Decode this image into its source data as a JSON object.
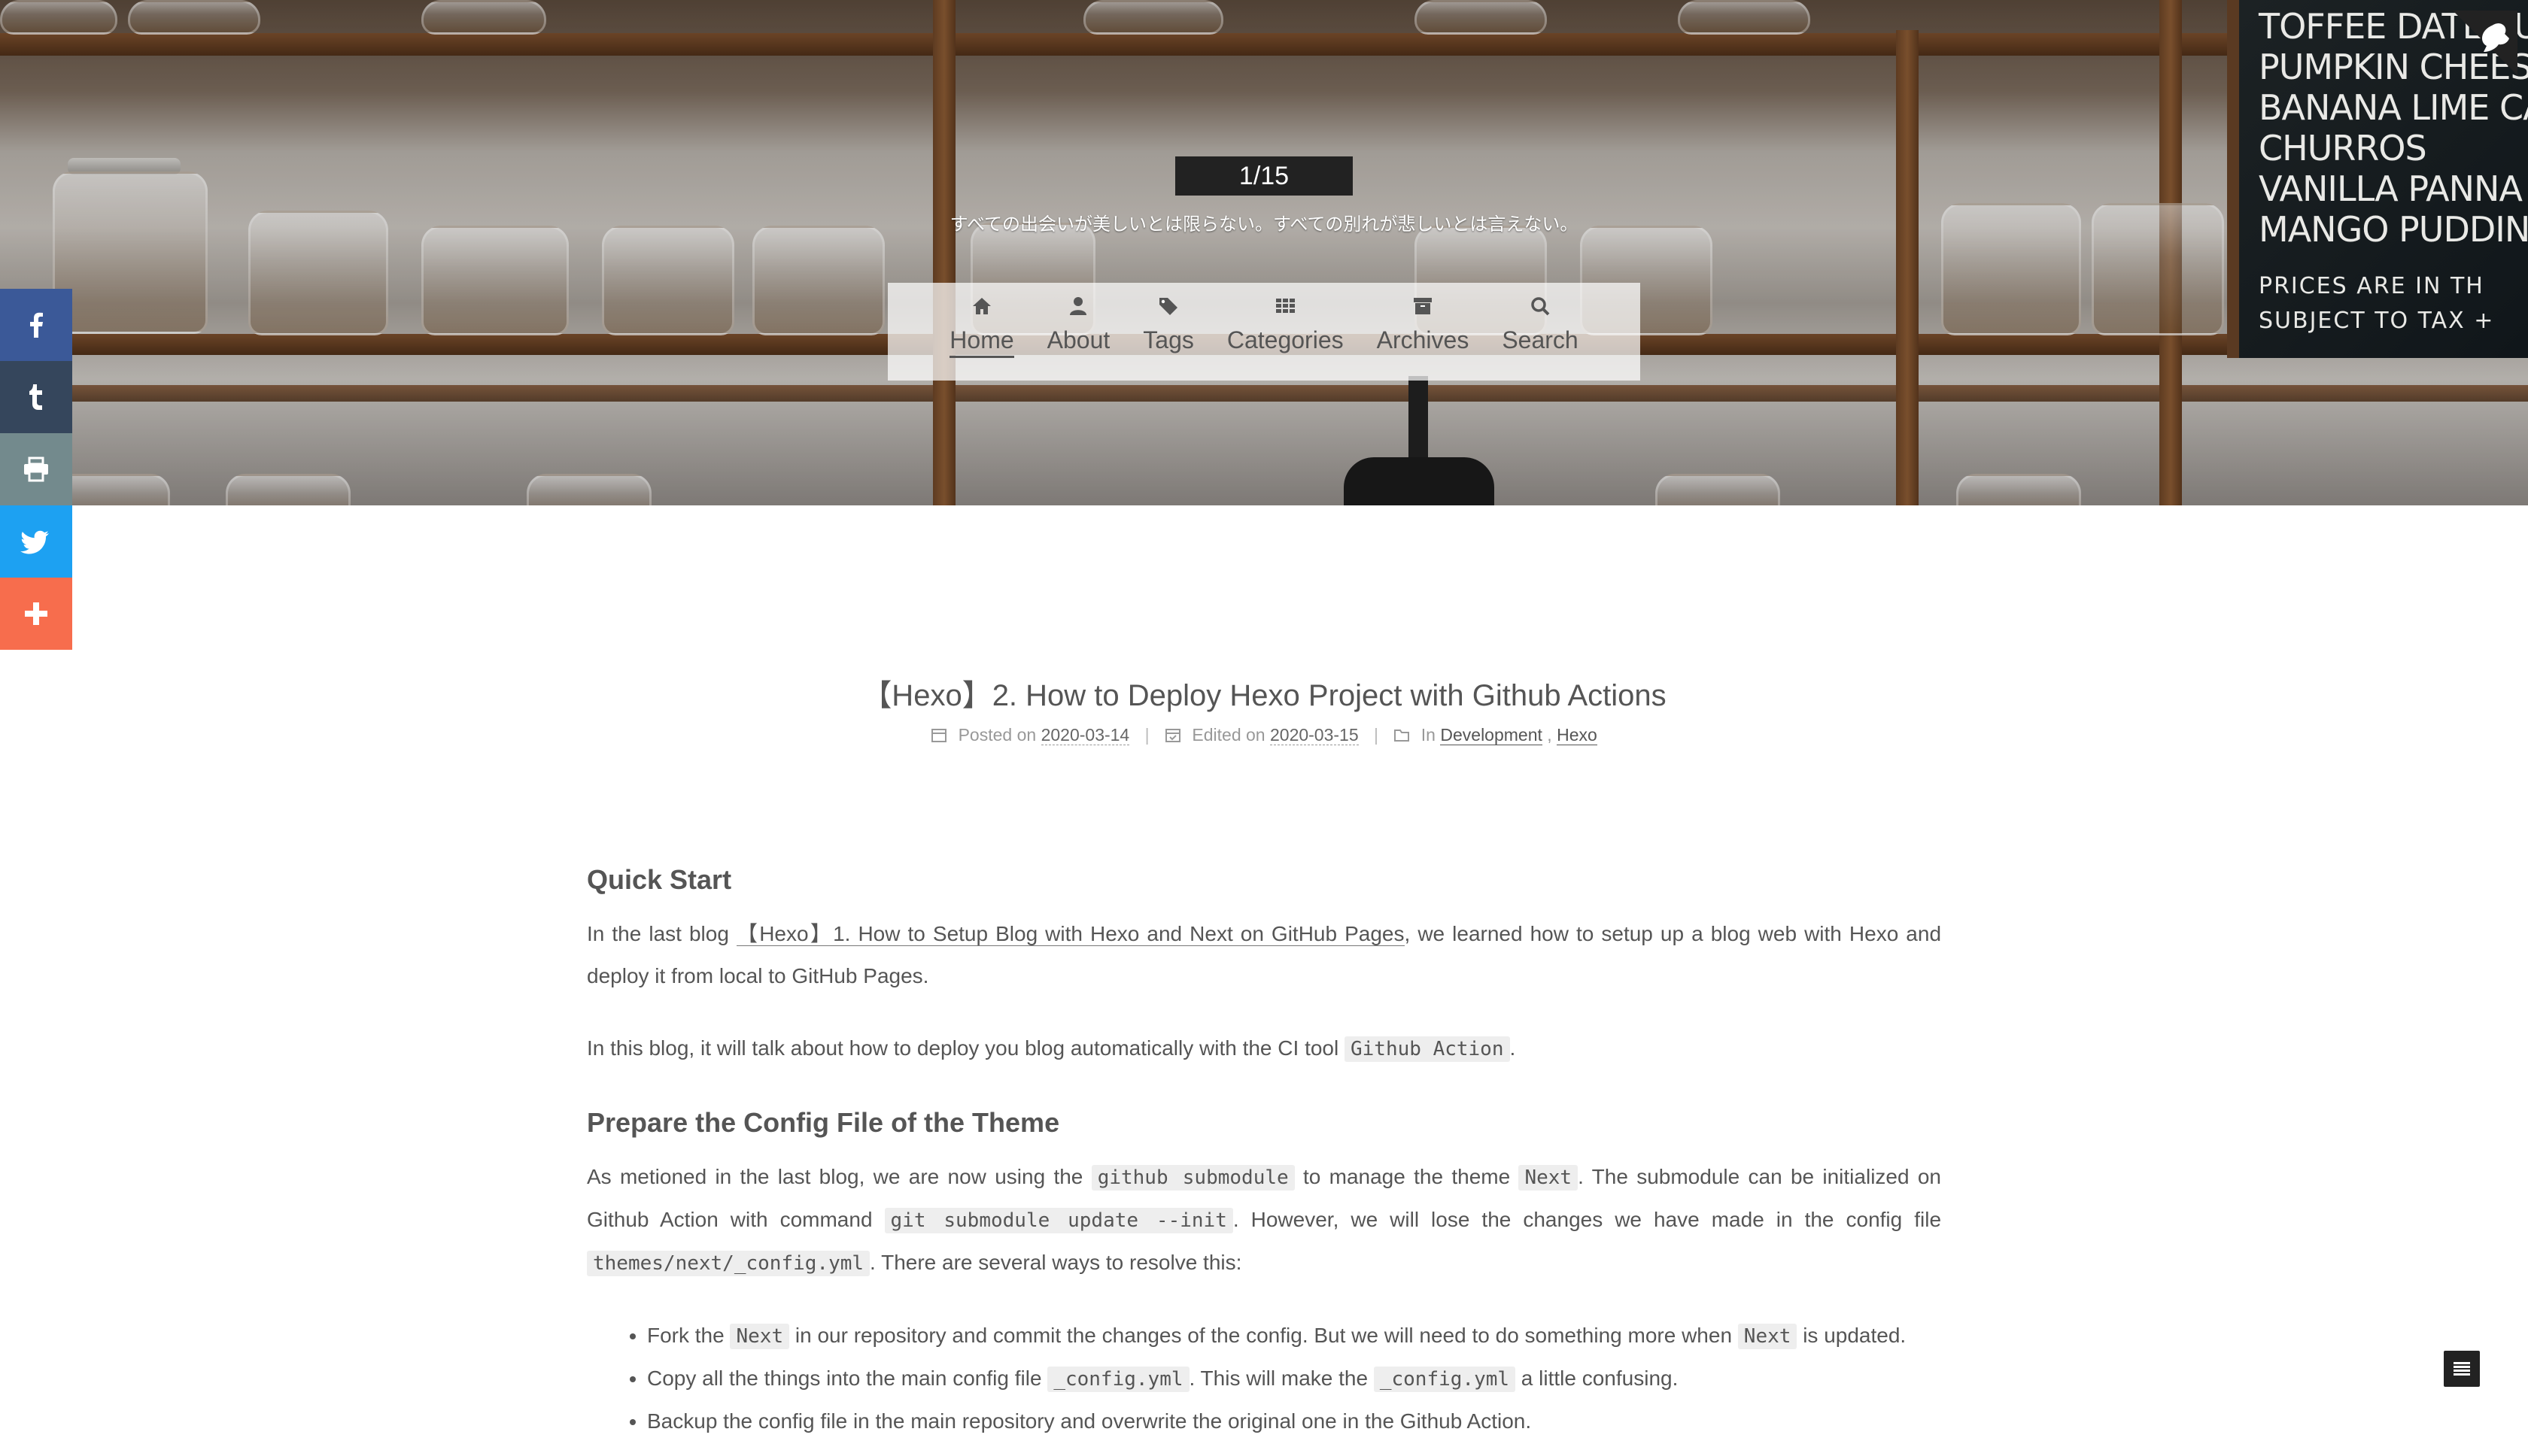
{
  "header": {
    "counter": "1/15",
    "tagline": "すべての出会いが美しいとは限らない。すべての別れが悲しいとは言えない。",
    "chalkboard": [
      "TOFFEE DATE PUD",
      "PUMPKIN CHEESE",
      "BANANA LIME CAKE",
      "CHURROS",
      "VANILLA PANNA CO",
      "MANGO PUDDING",
      "PRICES ARE IN TH",
      "SUBJECT TO TAX +"
    ]
  },
  "menu": {
    "items": [
      {
        "label": "Home",
        "icon": "home-icon",
        "active": true
      },
      {
        "label": "About",
        "icon": "user-icon"
      },
      {
        "label": "Tags",
        "icon": "tags-icon"
      },
      {
        "label": "Categories",
        "icon": "grid-icon"
      },
      {
        "label": "Archives",
        "icon": "archive-icon"
      },
      {
        "label": "Search",
        "icon": "search-icon"
      }
    ]
  },
  "share": {
    "items": [
      {
        "name": "facebook",
        "color": "#3b5998"
      },
      {
        "name": "tumblr",
        "color": "#35465c"
      },
      {
        "name": "print",
        "color": "#738a8d"
      },
      {
        "name": "twitter",
        "color": "#1da1f2"
      },
      {
        "name": "more",
        "color": "#f76d4d"
      }
    ]
  },
  "post": {
    "title": "【Hexo】2. How to Deploy Hexo Project with Github Actions",
    "meta": {
      "posted_label": "Posted on",
      "posted_date": "2020-03-14",
      "edited_label": "Edited on",
      "edited_date": "2020-03-15",
      "in_label": "In",
      "category1": "Development",
      "category2": "Hexo",
      "sep": "|"
    },
    "h_quick_start": "Quick Start",
    "p1_a": "In the last blog ",
    "p1_link": "【Hexo】1. How to Setup Blog with Hexo and Next on GitHub Pages",
    "p1_b": ", we learned how to setup up a blog web with Hexo and deploy it from local to GitHub Pages.",
    "p2_a": "In this blog, it will talk about how to deploy you blog automatically with the CI tool ",
    "p2_code": "Github Action",
    "p2_b": ".",
    "h_prepare": "Prepare the Config File of the Theme",
    "p3_a": "As metioned in the last blog, we are now using the ",
    "p3_code1": "github submodule",
    "p3_b": " to manage the theme ",
    "p3_code2": "Next",
    "p3_c": ". The submodule can be initialized on Github Action with command ",
    "p3_code3": "git submodule update --init",
    "p3_d": ". However, we will lose the changes we have made in the config file ",
    "p3_code4": "themes/next/_config.yml",
    "p3_e": ". There are several ways to resolve this:",
    "li1_a": "Fork the ",
    "li1_code1": "Next",
    "li1_b": " in our repository and commit the changes of the config. But we will need to do something more when ",
    "li1_code2": "Next",
    "li1_c": " is updated.",
    "li2_a": "Copy all the things into the main config file ",
    "li2_code1": "_config.yml",
    "li2_b": ". This will make the ",
    "li2_code2": "_config.yml",
    "li2_c": " a little confusing.",
    "li3": "Backup the config file in the main repository and overwrite the original one in the Github Action."
  }
}
